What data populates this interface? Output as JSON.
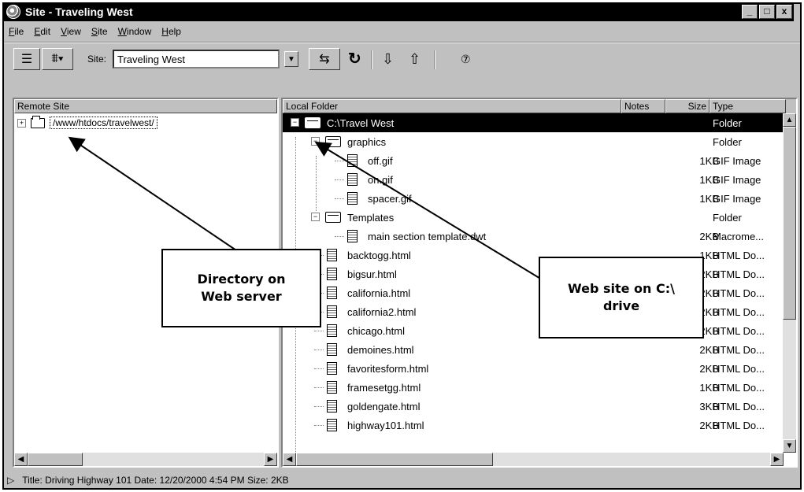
{
  "window": {
    "title": "Site - Traveling West",
    "min": "_",
    "max": "□",
    "close": "x"
  },
  "menu": [
    {
      "label": "File",
      "accel": "F",
      "rest": "ile"
    },
    {
      "label": "Edit",
      "accel": "E",
      "rest": "dit"
    },
    {
      "label": "View",
      "accel": "V",
      "rest": "iew"
    },
    {
      "label": "Site",
      "accel": "S",
      "rest": "ite"
    },
    {
      "label": "Window",
      "accel": "W",
      "rest": "indow"
    },
    {
      "label": "Help",
      "accel": "H",
      "rest": "elp"
    }
  ],
  "toolbar": {
    "site_label": "Site:",
    "site_value": "Traveling West"
  },
  "remote": {
    "header": "Remote Site",
    "path": "/www/htdocs/travelwest/"
  },
  "local": {
    "headers": {
      "folder": "Local Folder",
      "notes": "Notes",
      "size": "Size",
      "type": "Type"
    },
    "rows": [
      {
        "name": "C:\\Travel West",
        "size": "",
        "type": "Folder",
        "kind": "folder",
        "level": 0,
        "selected": true
      },
      {
        "name": "graphics",
        "size": "",
        "type": "Folder",
        "kind": "folder",
        "level": 1
      },
      {
        "name": "off.gif",
        "size": "1KB",
        "type": "GIF Image",
        "kind": "file",
        "level": 2
      },
      {
        "name": "on.gif",
        "size": "1KB",
        "type": "GIF Image",
        "kind": "file",
        "level": 2
      },
      {
        "name": "spacer.gif",
        "size": "1KB",
        "type": "GIF Image",
        "kind": "file",
        "level": 2
      },
      {
        "name": "Templates",
        "size": "",
        "type": "Folder",
        "kind": "folder",
        "level": 1
      },
      {
        "name": "main section template.dwt",
        "size": "2KB",
        "type": "Macrome...",
        "kind": "file",
        "level": 2
      },
      {
        "name": "backtogg.html",
        "size": "1KB",
        "type": "HTML Do...",
        "kind": "file",
        "level": 1
      },
      {
        "name": "bigsur.html",
        "size": "2KB",
        "type": "HTML Do...",
        "kind": "file",
        "level": 1
      },
      {
        "name": "california.html",
        "size": "2KB",
        "type": "HTML Do...",
        "kind": "file",
        "level": 1
      },
      {
        "name": "california2.html",
        "size": "2KB",
        "type": "HTML Do...",
        "kind": "file",
        "level": 1
      },
      {
        "name": "chicago.html",
        "size": "2KB",
        "type": "HTML Do...",
        "kind": "file",
        "level": 1
      },
      {
        "name": "demoines.html",
        "size": "2KB",
        "type": "HTML Do...",
        "kind": "file",
        "level": 1
      },
      {
        "name": "favoritesform.html",
        "size": "2KB",
        "type": "HTML Do...",
        "kind": "file",
        "level": 1
      },
      {
        "name": "framesetgg.html",
        "size": "1KB",
        "type": "HTML Do...",
        "kind": "file",
        "level": 1
      },
      {
        "name": "goldengate.html",
        "size": "3KB",
        "type": "HTML Do...",
        "kind": "file",
        "level": 1
      },
      {
        "name": "highway101.html",
        "size": "2KB",
        "type": "HTML Do...",
        "kind": "file",
        "level": 1
      }
    ]
  },
  "status": {
    "text": "Title: Driving Highway 101  Date: 12/20/2000 4:54 PM  Size: 2KB"
  },
  "callouts": {
    "server_line1": "Directory on",
    "server_line2": "Web server",
    "local_line1": "Web site on C:\\",
    "local_line2": "drive"
  }
}
